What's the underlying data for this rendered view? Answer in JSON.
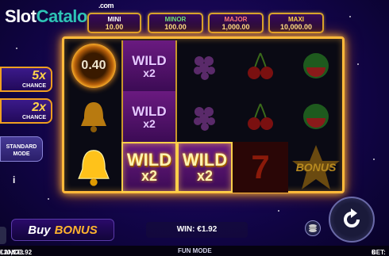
{
  "watermark": {
    "part1": "Slot",
    "part2": "Catalog",
    "com": ".com"
  },
  "jackpots": [
    {
      "label": "MINI",
      "value": "10.00"
    },
    {
      "label": "MINOR",
      "value": "100.00"
    },
    {
      "label": "MAJOR",
      "value": "1,000.00"
    },
    {
      "label": "MAXI",
      "value": "10,000.00"
    }
  ],
  "side_options": [
    {
      "multiplier": "5x",
      "label": "CHANCE"
    },
    {
      "multiplier": "2x",
      "label": "CHANCE"
    }
  ],
  "standard_mode": "STANDARD MODE",
  "info_label": "i",
  "reels": {
    "coin_value": "0.40",
    "wild_text": "WILD",
    "wild_mult": "x2",
    "bonus_text": "BONUS",
    "seven_text": "7"
  },
  "buy_bonus": {
    "buy": "Buy",
    "bonus": "BONUS"
  },
  "win": {
    "label": "WIN:",
    "value": "€1.92"
  },
  "bottom": {
    "balance_label": "LANCE:",
    "balance_value": "€10,973.92",
    "mode": "FUN MODE",
    "bet_label": "BET:",
    "bet_value": "€"
  },
  "colors": {
    "frame": "#ffb93a",
    "accent": "#ffd24a",
    "bg": "#12054a"
  }
}
